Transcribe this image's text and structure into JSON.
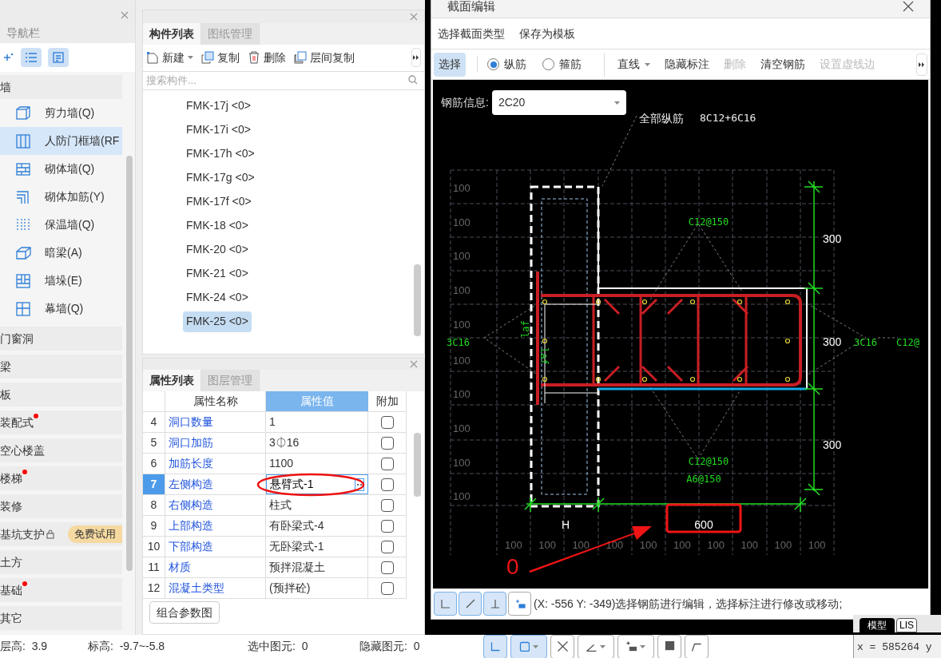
{
  "nav": {
    "title": "导航栏",
    "groups": [
      {
        "label": "墙",
        "dot": false,
        "locked": false,
        "children": [
          {
            "label": "剪力墙(Q)",
            "selected": false
          },
          {
            "label": "人防门框墙(RF",
            "selected": true
          },
          {
            "label": "砌体墙(Q)",
            "selected": false
          },
          {
            "label": "砌体加筋(Y)",
            "selected": false
          },
          {
            "label": "保温墙(Q)",
            "selected": false
          },
          {
            "label": "暗梁(A)",
            "selected": false
          },
          {
            "label": "墙垛(E)",
            "selected": false
          },
          {
            "label": "幕墙(Q)",
            "selected": false
          }
        ]
      },
      {
        "label": "门窗洞",
        "dot": false,
        "locked": false
      },
      {
        "label": "梁",
        "dot": false,
        "locked": false
      },
      {
        "label": "板",
        "dot": false,
        "locked": false
      },
      {
        "label": "装配式",
        "dot": true,
        "locked": false
      },
      {
        "label": "空心楼盖",
        "dot": false,
        "locked": false
      },
      {
        "label": "楼梯",
        "dot": true,
        "locked": false
      },
      {
        "label": "装修",
        "dot": false,
        "locked": false
      },
      {
        "label": "基坑支护",
        "dot": false,
        "locked": true,
        "badge": "免费试用"
      },
      {
        "label": "土方",
        "dot": false,
        "locked": false
      },
      {
        "label": "基础",
        "dot": true,
        "locked": false
      },
      {
        "label": "其它",
        "dot": false,
        "locked": false
      }
    ]
  },
  "components": {
    "tabs": [
      {
        "label": "构件列表",
        "selected": true
      },
      {
        "label": "图纸管理",
        "selected": false
      }
    ],
    "toolbar": [
      "新建",
      "复制",
      "删除",
      "层间复制"
    ],
    "search": {
      "placeholder": "搜索构件..."
    },
    "items": [
      {
        "label": "FMK-17j <0>",
        "selected": false
      },
      {
        "label": "FMK-17i <0>",
        "selected": false
      },
      {
        "label": "FMK-17h <0>",
        "selected": false
      },
      {
        "label": "FMK-17g <0>",
        "selected": false
      },
      {
        "label": "FMK-17f <0>",
        "selected": false
      },
      {
        "label": "FMK-18 <0>",
        "selected": false
      },
      {
        "label": "FMK-20 <0>",
        "selected": false
      },
      {
        "label": "FMK-21 <0>",
        "selected": false
      },
      {
        "label": "FMK-24 <0>",
        "selected": false
      },
      {
        "label": "FMK-25 <0>",
        "selected": true
      }
    ]
  },
  "properties": {
    "tabs": [
      {
        "label": "属性列表",
        "selected": true
      },
      {
        "label": "图层管理",
        "selected": false
      }
    ],
    "columns": [
      "属性名称",
      "属性值",
      "附加"
    ],
    "rows": [
      {
        "index": "4",
        "name": "洞口数量",
        "value": "1",
        "checked": false,
        "selected": false
      },
      {
        "index": "5",
        "name": "洞口加筋",
        "value": "3⏀16",
        "checked": false,
        "selected": false
      },
      {
        "index": "6",
        "name": "加筋长度",
        "value": "1100",
        "checked": false,
        "selected": false
      },
      {
        "index": "7",
        "name": "左侧构造",
        "value": "悬臂式-1",
        "checked": false,
        "selected": true
      },
      {
        "index": "8",
        "name": "右侧构造",
        "value": "柱式",
        "checked": false,
        "selected": false
      },
      {
        "index": "9",
        "name": "上部构造",
        "value": "有卧梁式-4",
        "checked": false,
        "selected": false
      },
      {
        "index": "10",
        "name": "下部构造",
        "value": "无卧梁式-1",
        "checked": false,
        "selected": false
      },
      {
        "index": "11",
        "name": "材质",
        "value": "预拌混凝土",
        "checked": false,
        "selected": false
      },
      {
        "index": "12",
        "name": "混凝土类型",
        "value": "(预拌砼)",
        "checked": false,
        "selected": false
      }
    ],
    "button": "组合参数图"
  },
  "status_bar": [
    {
      "label": "层高:",
      "value": "3.9"
    },
    {
      "label": "标高:",
      "value": "-9.7~-5.8"
    },
    {
      "label": "选中图元:",
      "value": "0"
    },
    {
      "label": "隐藏图元:",
      "value": "0"
    }
  ],
  "dialog": {
    "title": "截面编辑",
    "menu": [
      "选择截面类型",
      "保存为模板"
    ],
    "tools": [
      {
        "kind": "button",
        "label": "选择",
        "selected": true,
        "disabled": false
      },
      {
        "kind": "radio",
        "label": "纵筋",
        "selected": true,
        "disabled": false
      },
      {
        "kind": "radio",
        "label": "箍筋",
        "selected": false,
        "disabled": false
      },
      {
        "kind": "dropdown",
        "label": "直线",
        "selected": false,
        "disabled": false
      },
      {
        "kind": "button",
        "label": "隐藏标注",
        "selected": false,
        "disabled": false
      },
      {
        "kind": "button",
        "label": "删除",
        "selected": false,
        "disabled": true
      },
      {
        "kind": "button",
        "label": "清空钢筋",
        "selected": false,
        "disabled": false
      },
      {
        "kind": "button",
        "label": "设置虚线边",
        "selected": false,
        "disabled": true
      }
    ],
    "info_label": "钢筋信息:",
    "info_value": "2C20",
    "drawing": {
      "all_bars_label": "全部纵筋",
      "all_bars_value": "8C12+6C16",
      "left_ticks": [
        "100",
        "100",
        "100",
        "100",
        "100",
        "100",
        "100",
        "100",
        "100",
        "100"
      ],
      "bottom_ticks": [
        "100",
        "100",
        "100",
        "100",
        "100",
        "100",
        "100",
        "100",
        "100",
        "100"
      ],
      "side_dims": [
        "300",
        "300",
        "300"
      ],
      "width_dims": [
        "H",
        "600"
      ],
      "bar_labels": [
        "3C16",
        "C12@150",
        "C12@150",
        "A6@150",
        "3C16",
        "C12@",
        "laf",
        "laf"
      ],
      "annotation": "0"
    },
    "snap_tools": [
      {
        "selected": true
      },
      {
        "selected": true
      },
      {
        "selected": true
      },
      {
        "selected": false
      }
    ],
    "status": "(X: -556 Y: -349)选择钢筋进行编辑，选择标注进行修改或移动;"
  },
  "bottom_right": {
    "tab": "模型",
    "tab_2": "LIS",
    "coords": "x = 585264 y"
  }
}
